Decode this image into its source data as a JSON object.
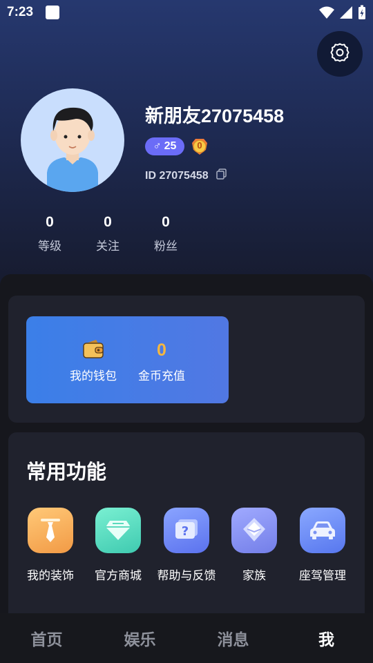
{
  "status_bar": {
    "time": "7:23"
  },
  "profile": {
    "username": "新朋友27075458",
    "gender_symbol": "♂",
    "age": "25",
    "level_badge": "0",
    "user_id": "ID 27075458"
  },
  "stats": [
    {
      "value": "0",
      "label": "等级"
    },
    {
      "value": "0",
      "label": "关注"
    },
    {
      "value": "0",
      "label": "粉丝"
    }
  ],
  "wallet": {
    "my_wallet_label": "我的钱包",
    "coin_amount": "0",
    "recharge_label": "金币充值"
  },
  "functions": {
    "title": "常用功能",
    "items": [
      {
        "label": "我的装饰",
        "icon": "tie-icon",
        "color": "#f7a94e"
      },
      {
        "label": "官方商城",
        "icon": "diamond-icon",
        "color": "#5fe0c4"
      },
      {
        "label": "帮助与反馈",
        "icon": "help-icon",
        "color": "#6f8cf5"
      },
      {
        "label": "家族",
        "icon": "family-icon",
        "color": "#8a95f2"
      },
      {
        "label": "座驾管理",
        "icon": "car-icon",
        "color": "#6a8cf6"
      }
    ]
  },
  "bottom_nav": {
    "tabs": [
      "首页",
      "娱乐",
      "消息",
      "我"
    ],
    "active": "我"
  }
}
